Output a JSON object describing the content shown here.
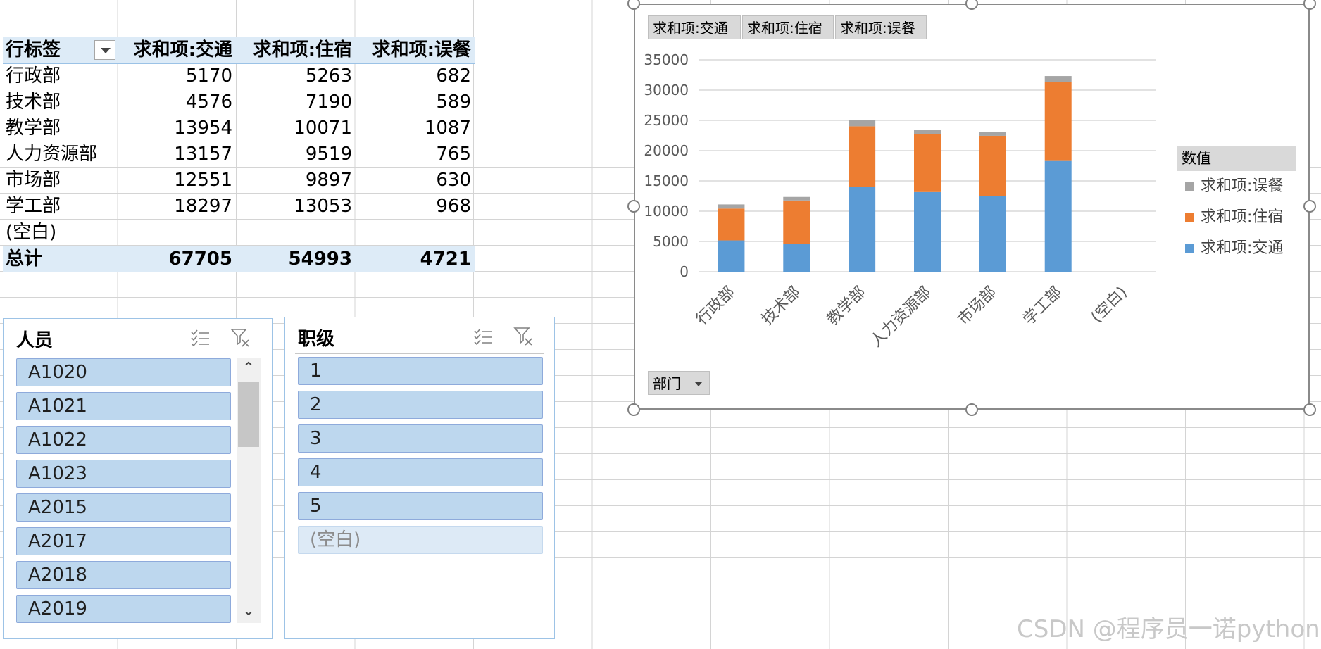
{
  "pivot": {
    "headers": [
      "行标签",
      "求和项:交通",
      "求和项:住宿",
      "求和项:误餐"
    ],
    "rows": [
      [
        "行政部",
        "5170",
        "5263",
        "682"
      ],
      [
        "技术部",
        "4576",
        "7190",
        "589"
      ],
      [
        "教学部",
        "13954",
        "10071",
        "1087"
      ],
      [
        "人力资源部",
        "13157",
        "9519",
        "765"
      ],
      [
        "市场部",
        "12551",
        "9897",
        "630"
      ],
      [
        "学工部",
        "18297",
        "13053",
        "968"
      ],
      [
        "(空白)",
        "",
        "",
        ""
      ]
    ],
    "total": [
      "总计",
      "67705",
      "54993",
      "4721"
    ],
    "dropdown_icon": "filter-dropdown-icon"
  },
  "slicer_person": {
    "title": "人员",
    "items": [
      "A1020",
      "A1021",
      "A1022",
      "A1023",
      "A2015",
      "A2017",
      "A2018",
      "A2019"
    ],
    "multiselect_icon": "multi-select-icon",
    "clear_icon": "clear-filter-icon",
    "scroll_up": "⌃",
    "scroll_down": "⌄"
  },
  "slicer_level": {
    "title": "职级",
    "items": [
      "1",
      "2",
      "3",
      "4",
      "5"
    ],
    "nodata_item": "(空白)",
    "multiselect_icon": "multi-select-icon",
    "clear_icon": "clear-filter-icon"
  },
  "chart_field_buttons": [
    "求和项:交通",
    "求和项:住宿",
    "求和项:误餐"
  ],
  "chart_axis_button": "部门",
  "chart_data": {
    "type": "bar",
    "stacked": true,
    "categories": [
      "行政部",
      "技术部",
      "教学部",
      "人力资源部",
      "市场部",
      "学工部",
      "(空白)"
    ],
    "series": [
      {
        "name": "求和项:交通",
        "values": [
          5170,
          4576,
          13954,
          13157,
          12551,
          18297,
          0
        ],
        "color": "#5b9bd5"
      },
      {
        "name": "求和项:住宿",
        "values": [
          5263,
          7190,
          10071,
          9519,
          9897,
          13053,
          0
        ],
        "color": "#ed7d31"
      },
      {
        "name": "求和项:误餐",
        "values": [
          682,
          589,
          1087,
          765,
          630,
          968,
          0
        ],
        "color": "#a5a5a5"
      }
    ],
    "y_ticks": [
      "0",
      "5000",
      "10000",
      "15000",
      "20000",
      "25000",
      "30000",
      "35000"
    ],
    "ylim": [
      0,
      35000
    ],
    "grid": true,
    "legend_title": "数值",
    "legend_order": [
      "求和项:误餐",
      "求和项:住宿",
      "求和项:交通"
    ],
    "legend_position": "right"
  },
  "watermark": "CSDN @程序员一诺python"
}
